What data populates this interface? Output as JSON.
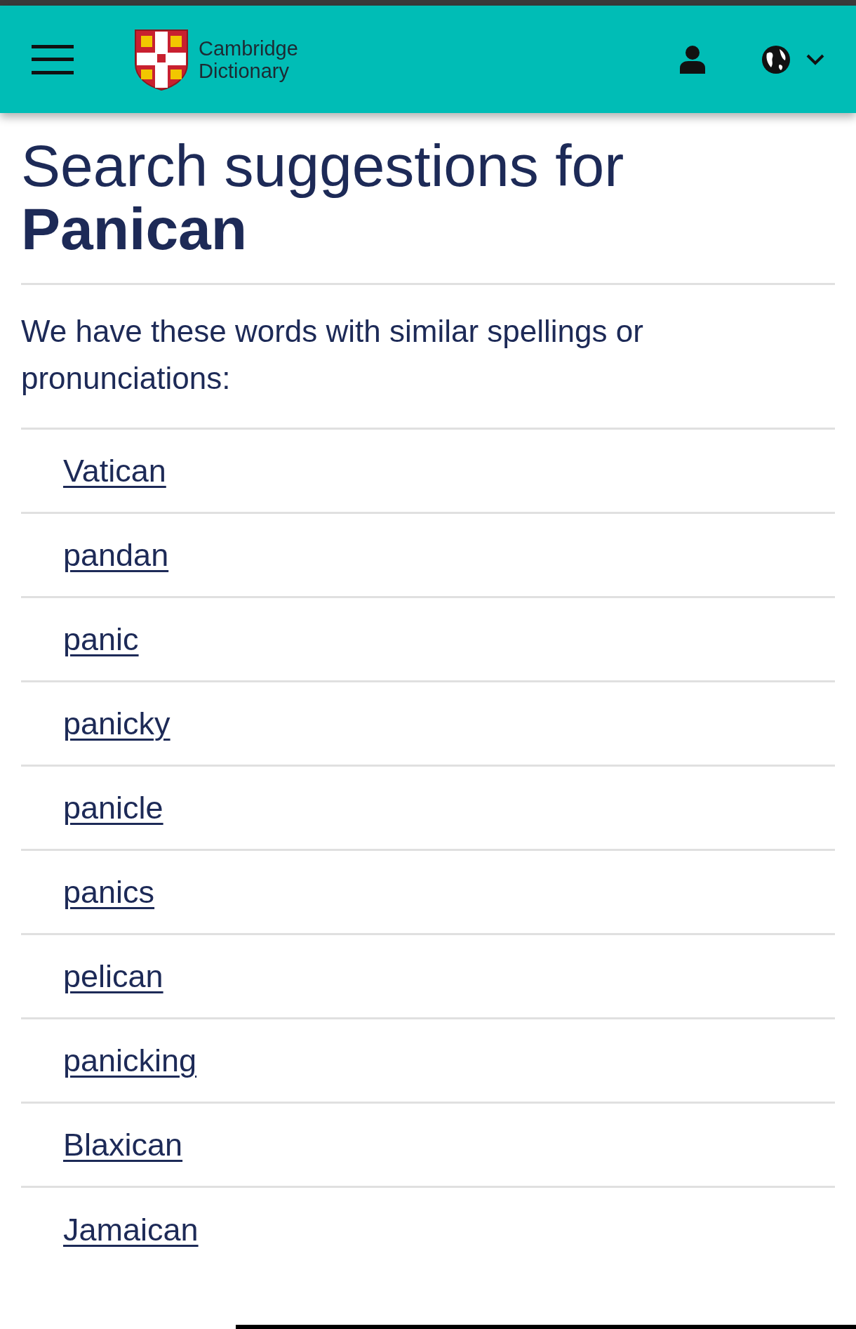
{
  "header": {
    "logo_line_1": "Cambridge",
    "logo_line_2": "Dictionary"
  },
  "heading": "Search suggestions for **Panican**",
  "intro": "We have these words with similar spellings or pronunciations:",
  "suggestions": [
    "Vatican",
    "pandan",
    "panic",
    "panicky",
    "panicle",
    "panics",
    "pelican",
    "panicking",
    "Blaxican",
    "Jamaican"
  ]
}
